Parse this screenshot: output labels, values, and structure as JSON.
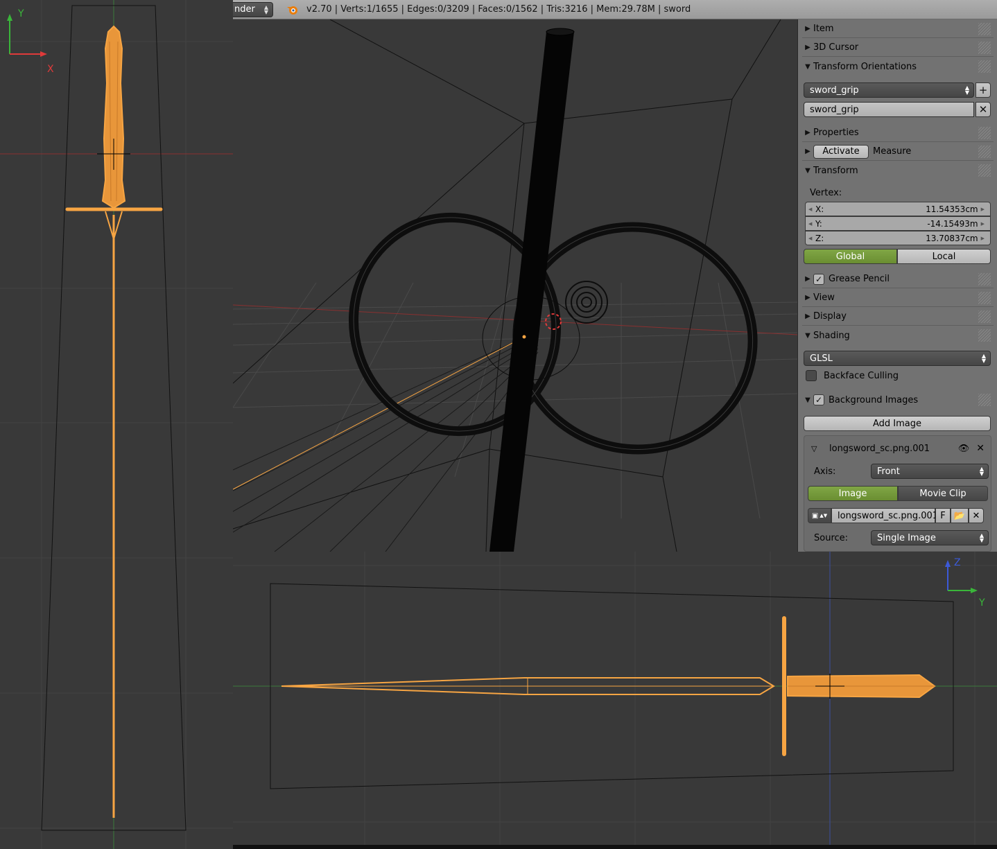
{
  "header": {
    "engine_label": "nder",
    "stats": "v2.70 | Verts:1/1655 | Edges:0/3209 | Faces:0/1562 | Tris:3216 | Mem:29.78M | sword"
  },
  "viewports": {
    "top": {
      "axis_y": "Y",
      "axis_x": "X"
    },
    "side": {
      "axis_z": "Z",
      "axis_y": "Y"
    }
  },
  "panel": {
    "sections": {
      "item": "Item",
      "cursor": "3D Cursor",
      "orientations": "Transform Orientations",
      "properties": "Properties",
      "measure": "Measure",
      "transform": "Transform",
      "grease": "Grease Pencil",
      "view": "View",
      "display": "Display",
      "shading": "Shading",
      "bgimages": "Background Images"
    },
    "orientation_select": "sword_grip",
    "orientation_name": "sword_grip",
    "activate_label": "Activate",
    "vertex_label": "Vertex:",
    "vertex": {
      "x_label": "X:",
      "x": "11.54353cm",
      "y_label": "Y:",
      "y": "-14.15493m",
      "z_label": "Z:",
      "z": "13.70837cm"
    },
    "global_label": "Global",
    "local_label": "Local",
    "shading_mode": "GLSL",
    "backface_label": "Backface Culling",
    "add_image_label": "Add Image",
    "bg_image": {
      "name": "longsword_sc.png.001",
      "axis_label": "Axis:",
      "axis_value": "Front",
      "image_tab": "Image",
      "movieclip_tab": "Movie Clip",
      "image_name": "longsword_sc.png.001",
      "fake_user": "F",
      "source_label": "Source:",
      "source_value": "Single Image"
    }
  },
  "colors": {
    "viewport_bg": "#393939",
    "selection_orange": "#f7a543",
    "active_green": "#76a03d",
    "panel_bg": "#727272"
  }
}
